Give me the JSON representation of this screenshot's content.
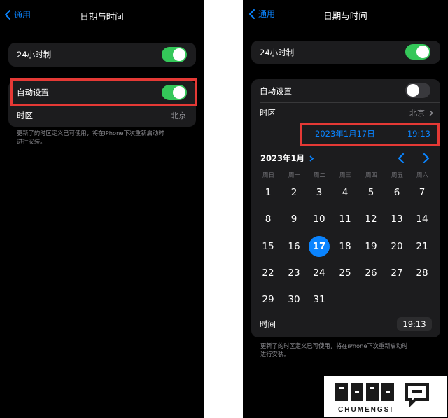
{
  "left": {
    "back_label": "通用",
    "title": "日期与时间",
    "row_24h_label": "24小时制",
    "row_auto_label": "自动设置",
    "row_timezone_label": "时区",
    "row_timezone_value": "北京",
    "footnote_line1": "更新了的时区定义已可使用，将在iPhone下次重新启动时",
    "footnote_line2": "进行安装。",
    "toggle_24h_on": true,
    "toggle_auto_on": true
  },
  "right": {
    "back_label": "通用",
    "title": "日期与时间",
    "row_24h_label": "24小时制",
    "row_auto_label": "自动设置",
    "row_timezone_label": "时区",
    "row_timezone_value": "北京",
    "selected_date": "2023年1月17日",
    "selected_time": "19:13",
    "month_label": "2023年1月",
    "weekdays": [
      "周日",
      "周一",
      "周二",
      "周三",
      "周四",
      "周五",
      "周六"
    ],
    "days": [
      "1",
      "2",
      "3",
      "4",
      "5",
      "6",
      "7",
      "8",
      "9",
      "10",
      "11",
      "12",
      "13",
      "14",
      "15",
      "16",
      "17",
      "18",
      "19",
      "20",
      "21",
      "22",
      "23",
      "24",
      "25",
      "26",
      "27",
      "28",
      "29",
      "30",
      "31"
    ],
    "first_weekday_index": 0,
    "selected_day_index": 16,
    "time_label": "时间",
    "time_value": "19:13",
    "footnote_line1": "更新了的时区定义已可使用，将在iPhone下次重新启动时",
    "footnote_line2": "进行安装。",
    "toggle_24h_on": true,
    "toggle_auto_on": false
  },
  "watermark": {
    "brand_text": "CHUMENGSI"
  },
  "colors": {
    "accent": "#0a84ff",
    "toggle_on": "#34c759",
    "highlight_border": "#e53935",
    "cell_bg": "#1c1c1e"
  }
}
